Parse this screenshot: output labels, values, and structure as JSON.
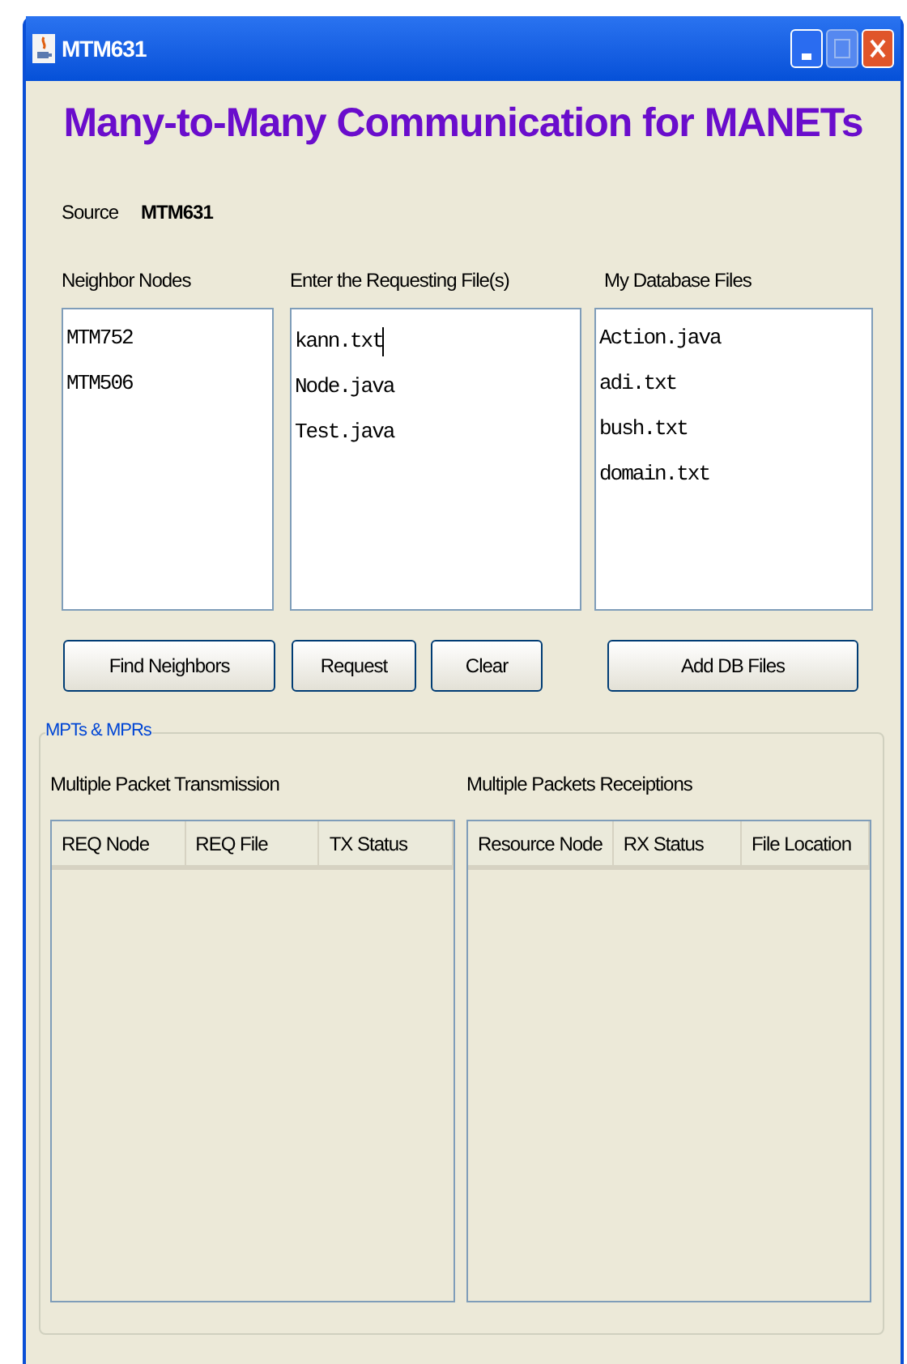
{
  "window": {
    "title": "MTM631"
  },
  "heading": "Many-to-Many Communication for MANETs",
  "source": {
    "label": "Source",
    "value": "MTM631"
  },
  "neighbors": {
    "label": "Neighbor Nodes",
    "items": [
      "MTM752",
      "MTM506"
    ]
  },
  "request": {
    "label": "Enter the Requesting File(s)",
    "lines": [
      "kann.txt",
      "Node.java",
      "Test.java"
    ]
  },
  "database": {
    "label": "My Database  Files",
    "items": [
      "Action.java",
      "adi.txt",
      "bush.txt",
      "domain.txt"
    ]
  },
  "buttons": [
    "Find Neighbors",
    "Request",
    "Clear",
    "Add DB Files"
  ],
  "group": {
    "title": "MPTs & MPRs",
    "transmission": {
      "title": "Multiple Packet Transmission",
      "columns": [
        "REQ Node",
        "REQ File",
        "TX Status"
      ]
    },
    "receptions": {
      "title": "Multiple Packets Receiptions",
      "columns": [
        "Resource Node",
        "RX Status",
        "File Location"
      ]
    }
  }
}
